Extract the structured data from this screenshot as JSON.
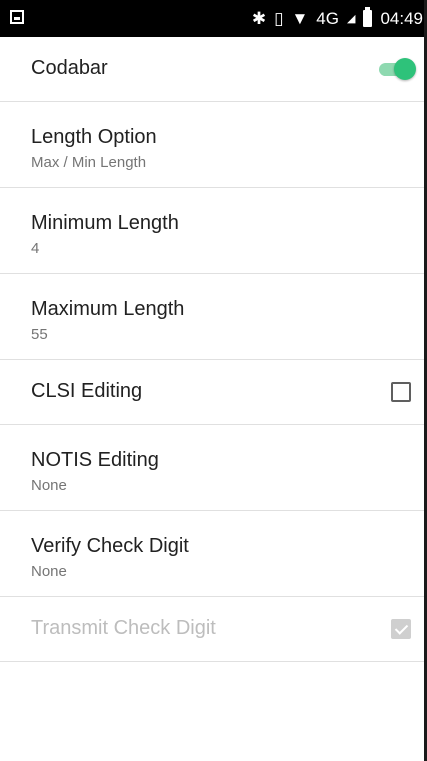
{
  "status_bar": {
    "time": "04:49",
    "network": "4G",
    "icons": [
      "bluetooth-icon",
      "vibrate-icon",
      "wifi-icon",
      "signal-icon",
      "battery-icon"
    ]
  },
  "settings": [
    {
      "title": "Codabar",
      "control": "switch",
      "state": "on"
    },
    {
      "title": "Length Option",
      "summary": "Max / Min Length"
    },
    {
      "title": "Minimum Length",
      "summary": "4"
    },
    {
      "title": "Maximum Length",
      "summary": "55"
    },
    {
      "title": "CLSI Editing",
      "control": "checkbox",
      "state": "unchecked"
    },
    {
      "title": "NOTIS Editing",
      "summary": "None"
    },
    {
      "title": "Verify Check Digit",
      "summary": "None"
    },
    {
      "title": "Transmit Check Digit",
      "control": "checkbox",
      "state": "checked-disabled"
    }
  ],
  "colors": {
    "accent": "#2ec27a",
    "accent_track": "#8ed9b0",
    "text_primary": "#212121",
    "text_secondary": "#757575",
    "text_disabled": "#bdbdbd"
  }
}
